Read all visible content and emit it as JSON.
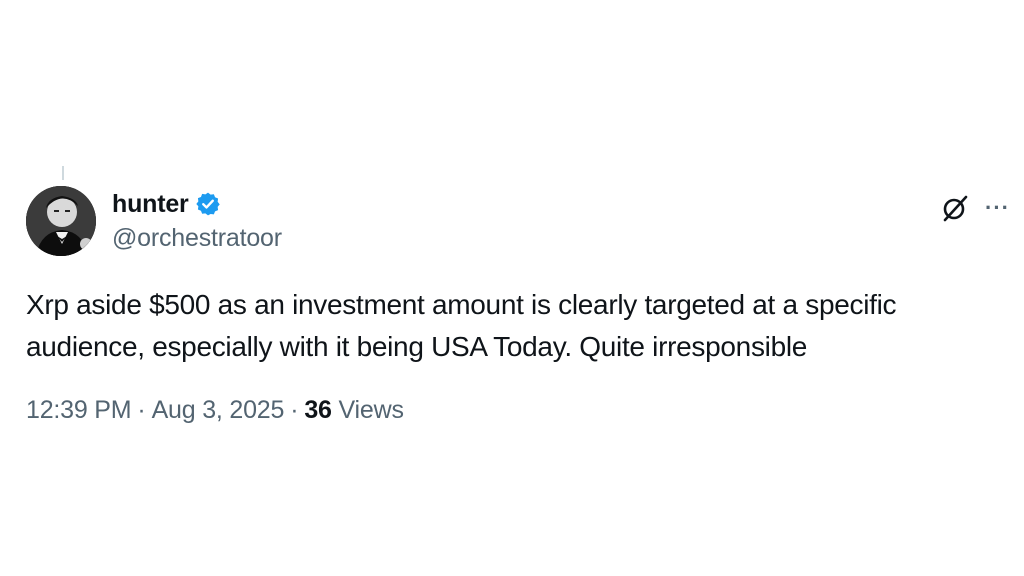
{
  "tweet": {
    "author": {
      "display_name": "hunter",
      "handle": "@orchestratoor",
      "verified": true,
      "verified_color": "#1d9bf0"
    },
    "text": "Xrp aside $500 as an investment amount is clearly targeted at a specific audience, especially with it being USA Today. Quite irresponsible",
    "meta": {
      "time": "12:39 PM",
      "date": "Aug 3, 2025",
      "separator": "·",
      "views_count": "36",
      "views_label": "Views"
    },
    "actions": {
      "grok_icon": "grok-icon",
      "more_icon": "more-icon",
      "more_label": "···"
    }
  }
}
